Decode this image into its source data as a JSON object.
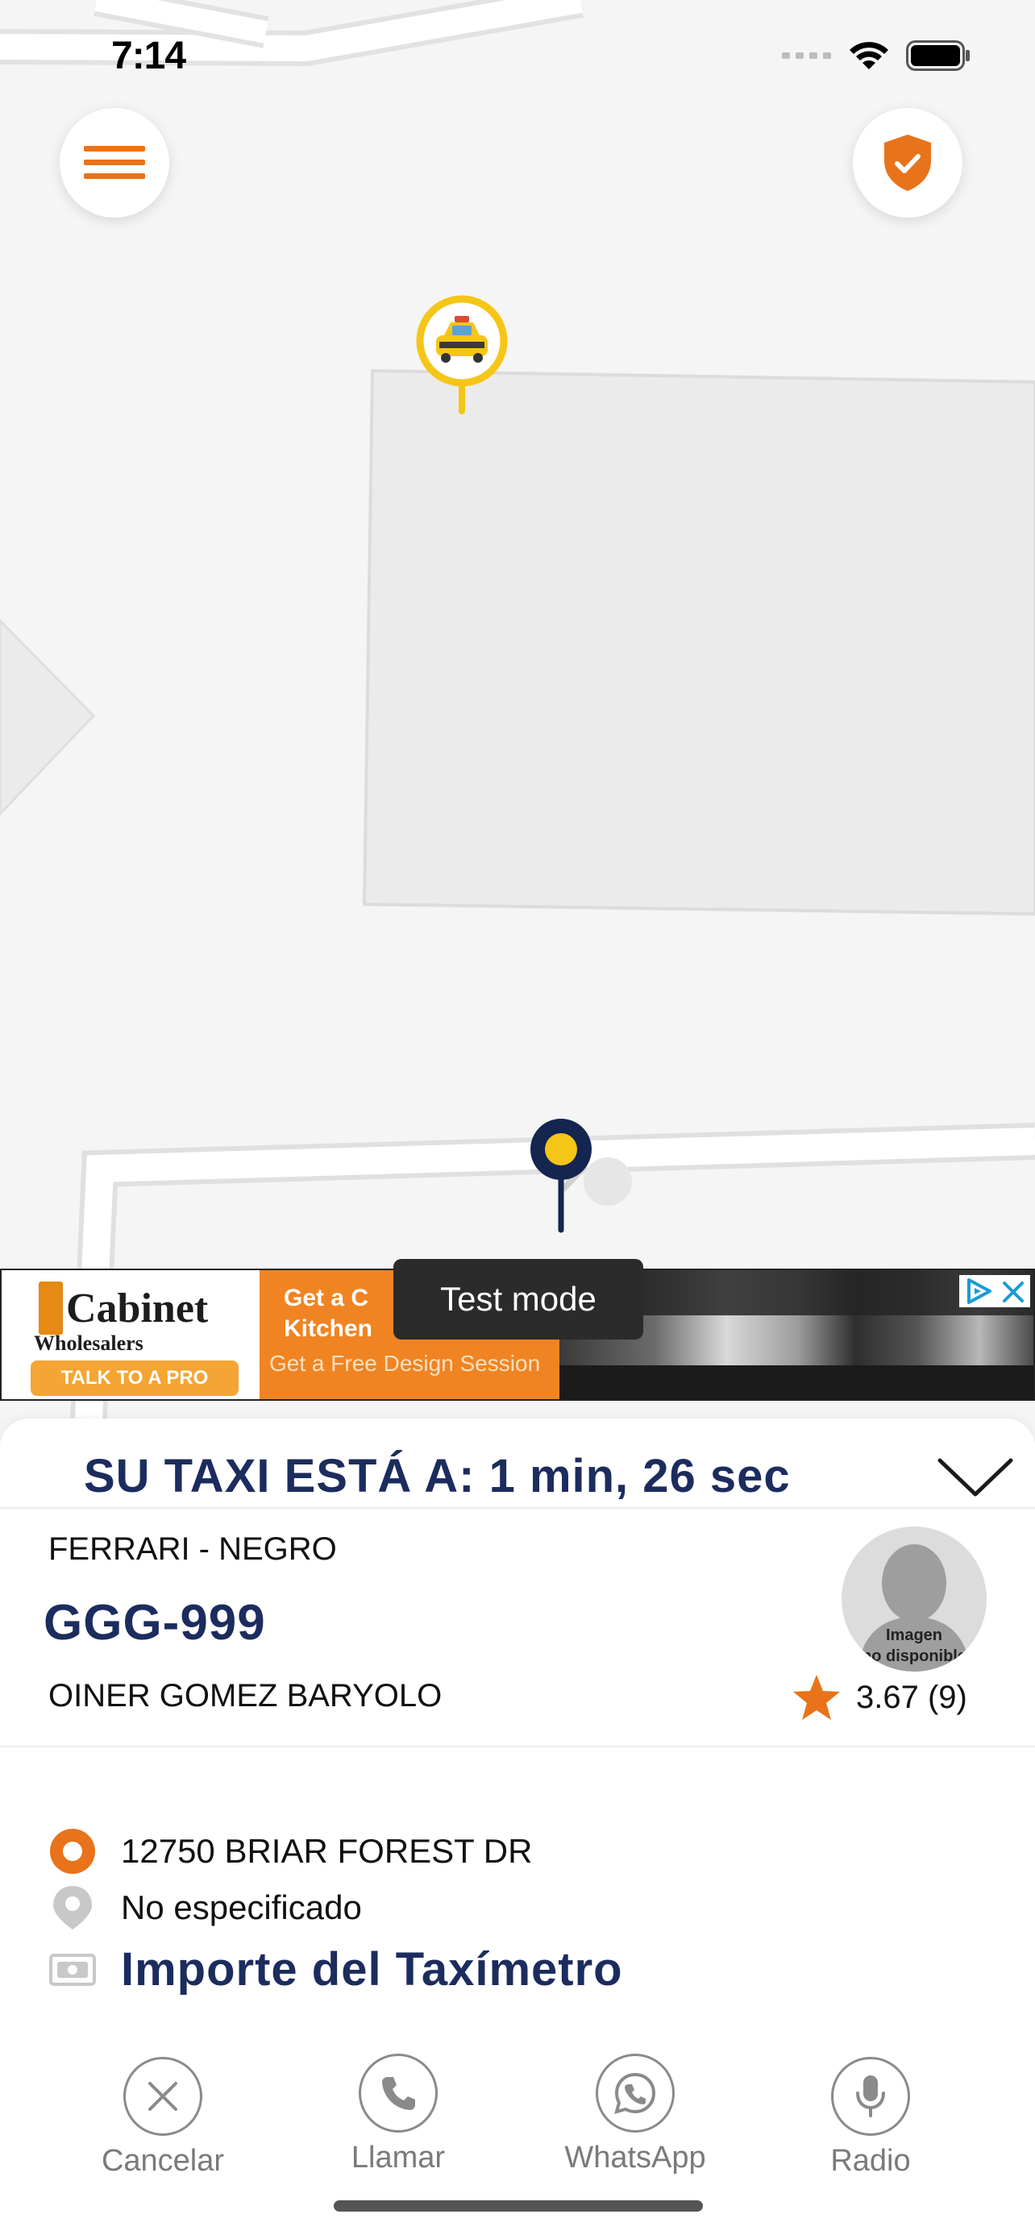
{
  "status_bar": {
    "time": "7:14",
    "signal_icon": "signal-dots-icon",
    "wifi_icon": "wifi-icon",
    "battery_icon": "battery-icon"
  },
  "map": {
    "menu_icon": "hamburger-menu-icon",
    "shield_icon": "shield-check-icon",
    "taxi_marker_icon": "taxi-marker-icon",
    "pickup_marker_icon": "pickup-pin-icon",
    "colors": {
      "accent": "#e8731a",
      "taxi_yellow": "#f5c518",
      "navy": "#1c2c5e"
    }
  },
  "ad": {
    "brand_name": "Cabinet",
    "brand_sub": "Wholesalers",
    "cta": "TALK TO A PRO",
    "headline": "Get a C Kitchen",
    "subline": "Get a Free Design Session",
    "adchoices_icon": "adchoices-icon",
    "close_icon": "close-icon"
  },
  "test_mode_label": "Test mode",
  "sheet": {
    "eta": "SU TAXI ESTÁ A: 1 min, 26 sec",
    "collapse_icon": "chevron-down-icon",
    "car_model": "FERRARI - NEGRO",
    "plate": "GGG-999",
    "driver_name": "OINER GOMEZ BARYOLO",
    "avatar_label_1": "Imagen",
    "avatar_label_2": "no disponible",
    "rating": "3.67 (9)",
    "rating_icon": "star-icon",
    "origin": "12750 BRIAR FOREST DR",
    "destination": "No especificado",
    "fare_label": "Importe del Taxímetro"
  },
  "actions": {
    "cancel": "Cancelar",
    "call": "Llamar",
    "whatsapp": "WhatsApp",
    "radio": "Radio"
  }
}
